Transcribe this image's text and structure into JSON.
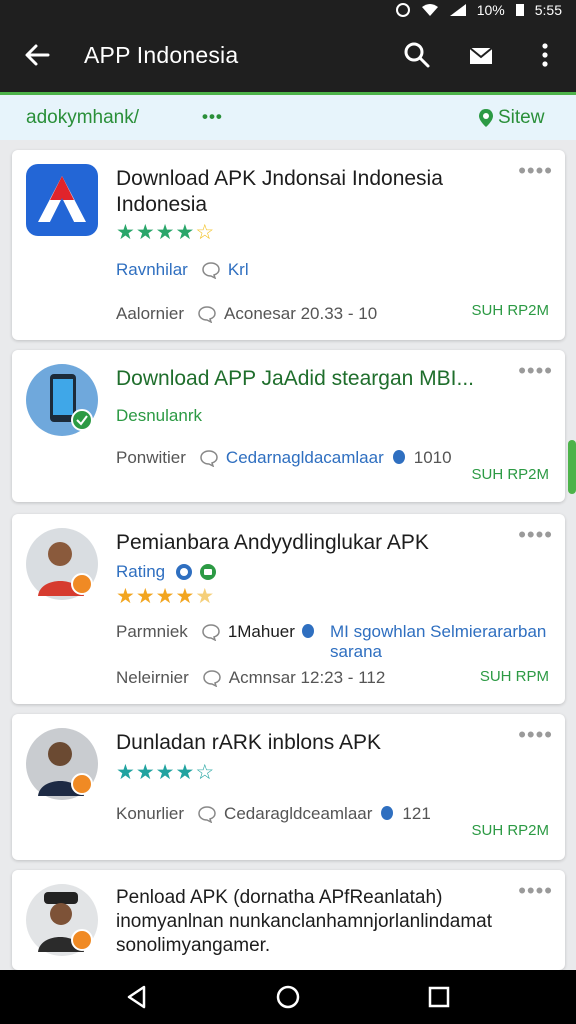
{
  "statusbar": {
    "battery": "10%",
    "time": "5:55"
  },
  "appbar": {
    "title": "APP Indonesia"
  },
  "urlbar": {
    "url": "adokymhank/",
    "dots": "•••",
    "site_label": "Sitew"
  },
  "cards": [
    {
      "title": "Download APK Jndonsai Indonesia Indonesia",
      "rating": 4,
      "line1_label": "Ravnhilar",
      "line1_value": "Krl",
      "line2_label": "Aalornier",
      "line2_value": "Aconesar 20.33 - 10",
      "sum": "SUH RP2M"
    },
    {
      "title": "Download APP JaAdid steargan MBI...",
      "subtitle": "Desnulanrk",
      "line2_label": "Ponwitier",
      "line2_value": "Cedarnagldacamlaar",
      "line2_count": "1010",
      "sum": "SUH RP2M"
    },
    {
      "title": "Pemianbara Andyydlinglukar APK",
      "badge": "Rating",
      "rating": 4,
      "line1_label": "Parmniek",
      "line1_value": "1Mahuer",
      "line1_blue": "MI sgowhlan Selmierararban sarana",
      "line2_label": "Neleirnier",
      "line2_value": "Acmnsar 12:23 - 112",
      "sum": "SUH RPM"
    },
    {
      "title": "Dunladan rARK inblons APK",
      "rating": 4,
      "line2_label": "Konurlier",
      "line2_value": "Cedaragldceamlaar",
      "line2_count": "121",
      "sum": "SUH RP2M"
    },
    {
      "title": "Penload APK (dornatha APfReanlatah) inomyanlnan nunkanclanhamnjorlanlindamat sonolimyangamer."
    }
  ],
  "colors": {
    "accent": "#2c9a44",
    "star": "#2aa66a",
    "star_orange": "#f2a51f",
    "link": "#2f6fc0"
  },
  "icons": [
    "back-arrow-icon",
    "search-icon",
    "share-icon",
    "more-vert-icon",
    "location-pin-icon",
    "chat-bubble-icon",
    "back-nav-icon",
    "home-nav-icon",
    "recents-nav-icon"
  ]
}
